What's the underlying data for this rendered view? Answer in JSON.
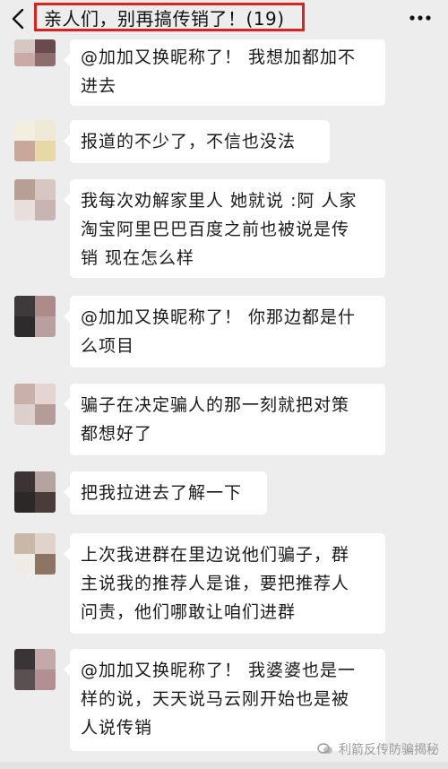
{
  "header": {
    "title": "亲人们，别再搞传销了！(19)",
    "back_icon": "chevron-left-icon",
    "more_icon": "more-dots-icon",
    "highlight_color": "#d9231f"
  },
  "messages": [
    {
      "text_lines": [
        "@加加又换昵称了！ 我想加都加不",
        "进去"
      ]
    },
    {
      "text_lines": [
        "报道的不少了，不信也没法"
      ]
    },
    {
      "text_lines": [
        "我每次劝解家里人 她就说 :阿 人家",
        "淘宝阿里巴巴百度之前也被说是传",
        "销 现在怎么样"
      ]
    },
    {
      "text_lines": [
        "@加加又换昵称了！ 你那边都是什",
        "么项目"
      ]
    },
    {
      "text_lines": [
        "骗子在决定骗人的那一刻就把对策",
        "都想好了"
      ]
    },
    {
      "text_lines": [
        "把我拉进去了解一下"
      ]
    },
    {
      "text_lines": [
        "上次我进群在里边说他们骗子，群",
        "主说我的推荐人是谁，要把推荐人",
        "问责，他们哪敢让咱们进群"
      ]
    },
    {
      "text_lines": [
        "@加加又换昵称了！ 我婆婆也是一",
        "样的说，天天说马云刚开始也是被",
        "人说传销"
      ]
    }
  ],
  "watermark": {
    "text": "利箭反传防骗揭秘",
    "icon": "wechat-channel-icon"
  }
}
